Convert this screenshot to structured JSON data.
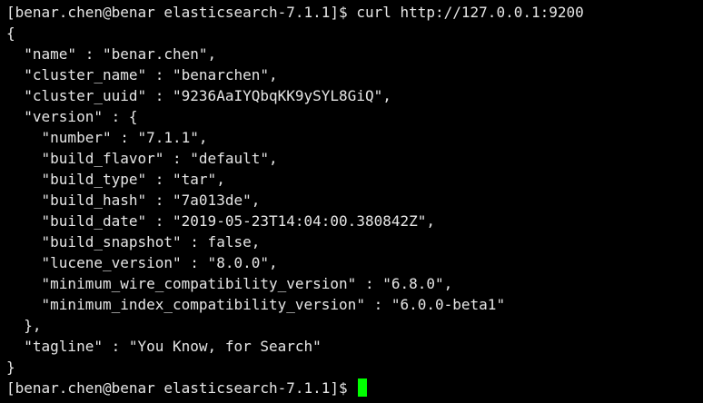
{
  "terminal": {
    "prompt": "[benar.chen@benar elasticsearch-7.1.1]$ ",
    "command": "curl http://127.0.0.1:9200",
    "output_lines": [
      "{",
      "  \"name\" : \"benar.chen\",",
      "  \"cluster_name\" : \"benarchen\",",
      "  \"cluster_uuid\" : \"9236AaIYQbqKK9ySYL8GiQ\",",
      "  \"version\" : {",
      "    \"number\" : \"7.1.1\",",
      "    \"build_flavor\" : \"default\",",
      "    \"build_type\" : \"tar\",",
      "    \"build_hash\" : \"7a013de\",",
      "    \"build_date\" : \"2019-05-23T14:04:00.380842Z\",",
      "    \"build_snapshot\" : false,",
      "    \"lucene_version\" : \"8.0.0\",",
      "    \"minimum_wire_compatibility_version\" : \"6.8.0\",",
      "    \"minimum_index_compatibility_version\" : \"6.0.0-beta1\"",
      "  },",
      "  \"tagline\" : \"You Know, for Search\"",
      "}"
    ],
    "final_prompt": "[benar.chen@benar elasticsearch-7.1.1]$ ",
    "colors": {
      "background": "#000000",
      "foreground": "#e6e6e6",
      "cursor": "#00ff00"
    }
  }
}
